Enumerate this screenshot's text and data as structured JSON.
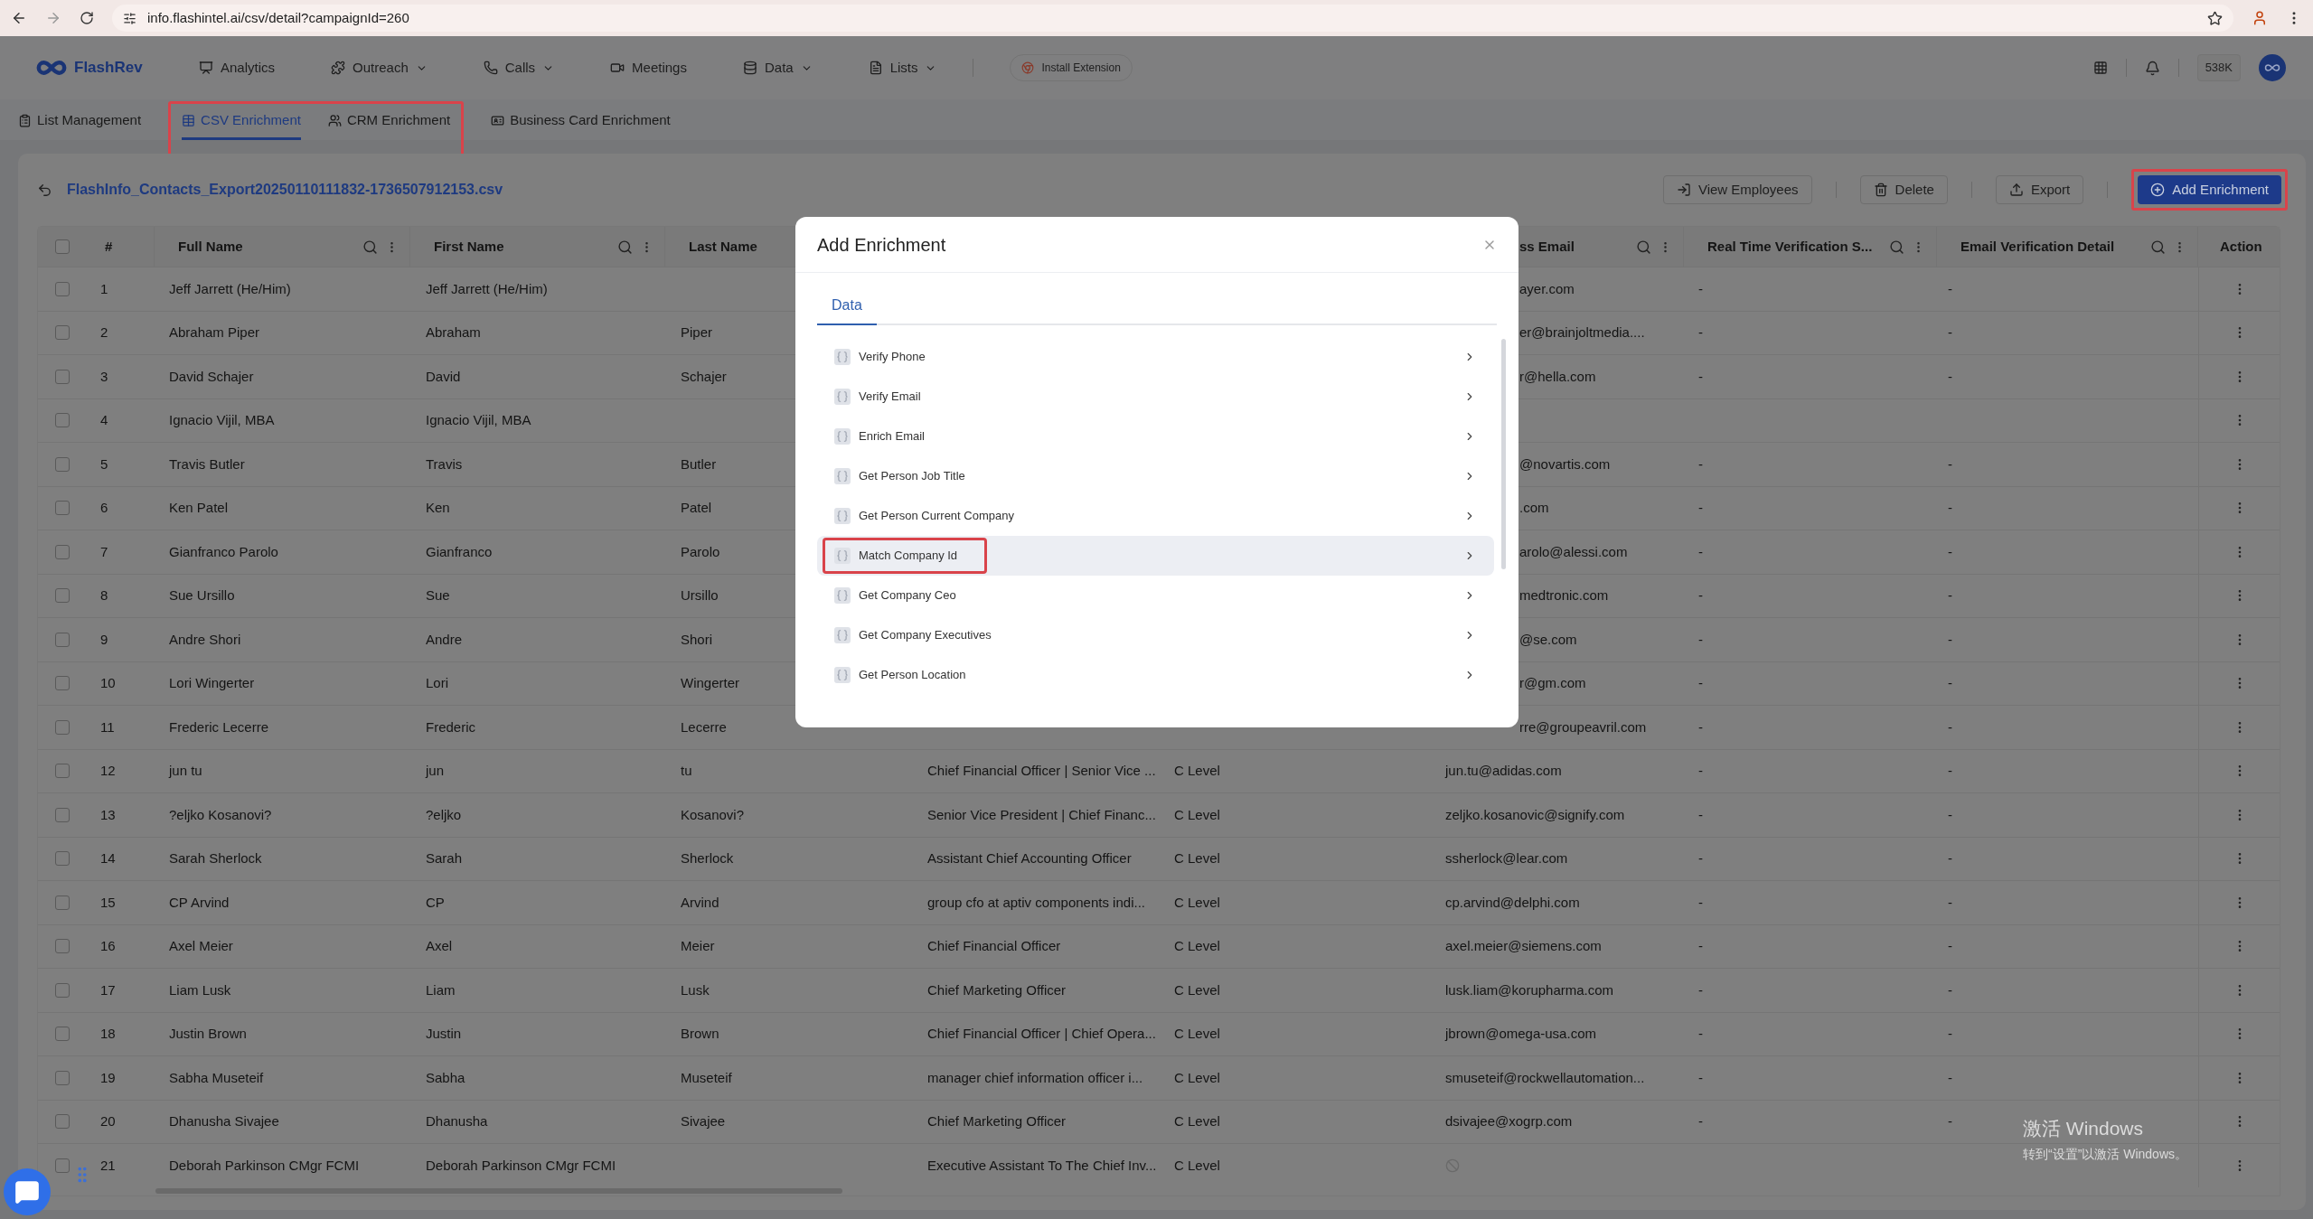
{
  "browser": {
    "url": "info.flashintel.ai/csv/detail?campaignId=260"
  },
  "nav": {
    "logo": "FlashRev",
    "items": [
      {
        "label": "Analytics",
        "has_menu": false
      },
      {
        "label": "Outreach",
        "has_menu": true
      },
      {
        "label": "Calls",
        "has_menu": true
      },
      {
        "label": "Meetings",
        "has_menu": false
      },
      {
        "label": "Data",
        "has_menu": true
      },
      {
        "label": "Lists",
        "has_menu": true
      }
    ],
    "install_extension": "Install Extension",
    "credits": "538K"
  },
  "sub_tabs": [
    {
      "label": "List Management",
      "selected": false,
      "annotated": false
    },
    {
      "label": "CSV Enrichment",
      "selected": true,
      "annotated": true
    },
    {
      "label": "CRM Enrichment",
      "selected": false,
      "annotated": true
    },
    {
      "label": "Business Card Enrichment",
      "selected": false,
      "annotated": false
    }
  ],
  "file": {
    "title": "FlashInfo_Contacts_Export20250110111832-1736507912153.csv",
    "buttons": [
      {
        "label": "View Employees",
        "kind": "enter",
        "annotated": false
      },
      {
        "label": "Delete",
        "kind": "delete",
        "annotated": false
      },
      {
        "label": "Export",
        "kind": "export",
        "annotated": false
      },
      {
        "label": "Add Enrichment",
        "kind": "primary",
        "annotated": true
      }
    ]
  },
  "table": {
    "header_checked": false,
    "columns": [
      {
        "label": "#",
        "tools": false
      },
      {
        "label": "Full Name",
        "tools": true
      },
      {
        "label": "First Name",
        "tools": true
      },
      {
        "label": "Last Name",
        "tools": false
      },
      {
        "label": "ss Email",
        "tools": true
      },
      {
        "label": "Real Time Verification S...",
        "tools": true
      },
      {
        "label": "Email Verification Detail",
        "tools": true
      },
      {
        "label": "Action",
        "tools": false
      }
    ],
    "rows": [
      {
        "n": "1",
        "checked": false,
        "full_name": "Jeff Jarrett (He/Him)",
        "first_name": "Jeff Jarrett (He/Him)",
        "email": "ayer.com",
        "email_missing": false,
        "rtv": "-",
        "evd": "-"
      },
      {
        "n": "2",
        "checked": false,
        "full_name": "Abraham Piper",
        "first_name": "Abraham",
        "last_name": "Piper",
        "email": "er@brainjoltmedia....",
        "email_missing": false,
        "rtv": "-",
        "evd": "-"
      },
      {
        "n": "3",
        "checked": false,
        "full_name": "David Schajer",
        "first_name": "David",
        "last_name": "Schajer",
        "email": "r@hella.com",
        "email_missing": false,
        "rtv": "-",
        "evd": "-"
      },
      {
        "n": "4",
        "checked": false,
        "full_name": "Ignacio Vijil, MBA",
        "first_name": "Ignacio Vijil, MBA",
        "email_missing": false
      },
      {
        "n": "5",
        "checked": false,
        "full_name": "Travis Butler",
        "first_name": "Travis",
        "last_name": "Butler",
        "email": "@novartis.com",
        "email_missing": false,
        "rtv": "-",
        "evd": "-"
      },
      {
        "n": "6",
        "checked": false,
        "full_name": "Ken Patel",
        "first_name": "Ken",
        "last_name": "Patel",
        "email": ".com",
        "email_missing": false,
        "rtv": "-",
        "evd": "-"
      },
      {
        "n": "7",
        "checked": false,
        "full_name": "Gianfranco Parolo",
        "first_name": "Gianfranco",
        "last_name": "Parolo",
        "email": "arolo@alessi.com",
        "email_missing": false,
        "rtv": "-",
        "evd": "-"
      },
      {
        "n": "8",
        "checked": false,
        "full_name": "Sue Ursillo",
        "first_name": "Sue",
        "last_name": "Ursillo",
        "email": "medtronic.com",
        "email_missing": false,
        "rtv": "-",
        "evd": "-"
      },
      {
        "n": "9",
        "checked": false,
        "full_name": "Andre Shori",
        "first_name": "Andre",
        "last_name": "Shori",
        "email": "@se.com",
        "email_missing": false,
        "rtv": "-",
        "evd": "-"
      },
      {
        "n": "10",
        "checked": false,
        "full_name": "Lori Wingerter",
        "first_name": "Lori",
        "last_name": "Wingerter",
        "email": "r@gm.com",
        "email_missing": false,
        "rtv": "-",
        "evd": "-"
      },
      {
        "n": "11",
        "checked": false,
        "full_name": "Frederic Lecerre",
        "first_name": "Frederic",
        "last_name": "Lecerre",
        "email": "rre@groupeavril.com",
        "email_missing": false,
        "rtv": "-",
        "evd": "-"
      },
      {
        "n": "12",
        "checked": false,
        "full_name": "jun tu",
        "first_name": "jun",
        "last_name": "tu",
        "job_title": "Chief Financial Officer | Senior Vice ...",
        "level": "C Level",
        "email": "jun.tu@adidas.com",
        "email_missing": false,
        "rtv": "-",
        "evd": "-"
      },
      {
        "n": "13",
        "checked": false,
        "full_name": "?eljko Kosanovi?",
        "first_name": "?eljko",
        "last_name": "Kosanovi?",
        "job_title": "Senior Vice President | Chief Financ...",
        "level": "C Level",
        "email": "zeljko.kosanovic@signify.com",
        "email_missing": false,
        "rtv": "-",
        "evd": "-"
      },
      {
        "n": "14",
        "checked": false,
        "full_name": "Sarah Sherlock",
        "first_name": "Sarah",
        "last_name": "Sherlock",
        "job_title": "Assistant Chief Accounting Officer",
        "level": "C Level",
        "email": "ssherlock@lear.com",
        "email_missing": false,
        "rtv": "-",
        "evd": "-"
      },
      {
        "n": "15",
        "checked": false,
        "full_name": "CP Arvind",
        "first_name": "CP",
        "last_name": "Arvind",
        "job_title": "group cfo at aptiv components indi...",
        "level": "C Level",
        "email": "cp.arvind@delphi.com",
        "email_missing": false,
        "rtv": "-",
        "evd": "-"
      },
      {
        "n": "16",
        "checked": false,
        "full_name": "Axel Meier",
        "first_name": "Axel",
        "last_name": "Meier",
        "job_title": "Chief Financial Officer",
        "level": "C Level",
        "email": "axel.meier@siemens.com",
        "email_missing": false,
        "rtv": "-",
        "evd": "-"
      },
      {
        "n": "17",
        "checked": false,
        "full_name": "Liam Lusk",
        "first_name": "Liam",
        "last_name": "Lusk",
        "job_title": "Chief Marketing Officer",
        "level": "C Level",
        "email": "lusk.liam@korupharma.com",
        "email_missing": false,
        "rtv": "-",
        "evd": "-"
      },
      {
        "n": "18",
        "checked": false,
        "full_name": "Justin Brown",
        "first_name": "Justin",
        "last_name": "Brown",
        "job_title": "Chief Financial Officer | Chief Opera...",
        "level": "C Level",
        "email": "jbrown@omega-usa.com",
        "email_missing": false,
        "rtv": "-",
        "evd": "-"
      },
      {
        "n": "19",
        "checked": false,
        "full_name": "Sabha Museteif",
        "first_name": "Sabha",
        "last_name": "Museteif",
        "job_title": "manager chief information officer i...",
        "level": "C Level",
        "email": "smuseteif@rockwellautomation...",
        "email_missing": false,
        "rtv": "-",
        "evd": "-"
      },
      {
        "n": "20",
        "checked": false,
        "full_name": "Dhanusha Sivajee",
        "first_name": "Dhanusha",
        "last_name": "Sivajee",
        "job_title": "Chief Marketing Officer",
        "level": "C Level",
        "email": "dsivajee@xogrp.com",
        "email_missing": false,
        "rtv": "-",
        "evd": "-"
      },
      {
        "n": "21",
        "checked": false,
        "full_name": "Deborah Parkinson CMgr FCMI",
        "first_name": "Deborah Parkinson CMgr FCMI",
        "job_title": "Executive Assistant To The Chief Inv...",
        "level": "C Level",
        "email_missing": true
      }
    ]
  },
  "modal": {
    "title": "Add Enrichment",
    "tabs": [
      {
        "label": "Data",
        "selected": true
      }
    ],
    "items": [
      {
        "label": "Verify Phone",
        "selected": false,
        "annotated": false
      },
      {
        "label": "Verify Email",
        "selected": false,
        "annotated": false
      },
      {
        "label": "Enrich Email",
        "selected": false,
        "annotated": false
      },
      {
        "label": "Get Person Job Title",
        "selected": false,
        "annotated": false
      },
      {
        "label": "Get Person Current Company",
        "selected": false,
        "annotated": false
      },
      {
        "label": "Match Company Id",
        "selected": true,
        "annotated": true
      },
      {
        "label": "Get Company Ceo",
        "selected": false,
        "annotated": false
      },
      {
        "label": "Get Company Executives",
        "selected": false,
        "annotated": false
      },
      {
        "label": "Get Person Location",
        "selected": false,
        "annotated": false
      }
    ]
  },
  "os_notice": {
    "title": "激活 Windows",
    "text": "转到“设置”以激活 Windows。"
  }
}
